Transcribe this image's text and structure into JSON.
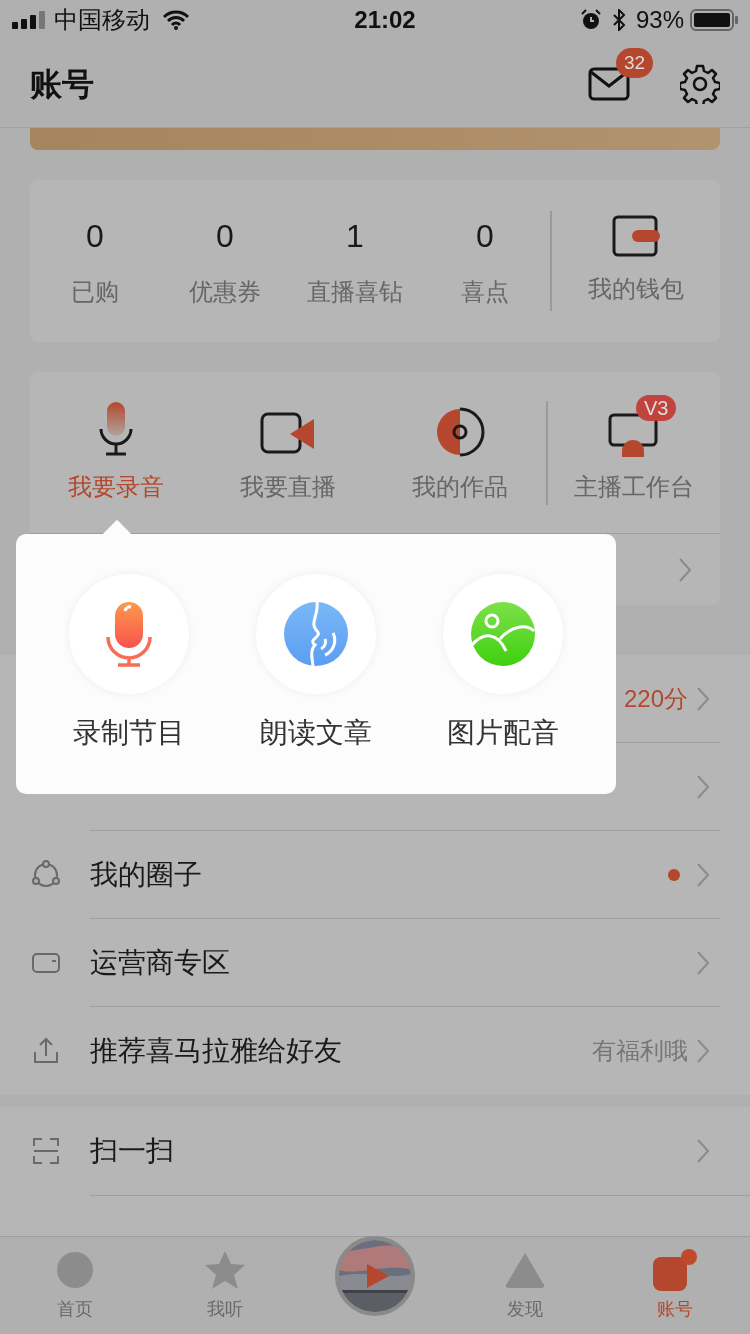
{
  "status_bar": {
    "carrier": "中国移动",
    "time": "21:02",
    "battery": "93%"
  },
  "header": {
    "title": "账号",
    "mail_badge": "32"
  },
  "stats": [
    {
      "value": "0",
      "label": "已购"
    },
    {
      "value": "0",
      "label": "优惠券"
    },
    {
      "value": "1",
      "label": "直播喜钻"
    },
    {
      "value": "0",
      "label": "喜点"
    }
  ],
  "wallet": {
    "label": "我的钱包"
  },
  "creator_actions": [
    {
      "kind": "mic",
      "label": "我要录音",
      "selected": true
    },
    {
      "kind": "live",
      "label": "我要直播",
      "selected": false
    },
    {
      "kind": "works",
      "label": "我的作品",
      "selected": false
    }
  ],
  "studio": {
    "label": "主播工作台",
    "badge": "V3"
  },
  "popup": {
    "items": [
      {
        "kind": "record",
        "label": "录制节目"
      },
      {
        "kind": "read",
        "label": "朗读文章"
      },
      {
        "kind": "dub",
        "label": "图片配音"
      }
    ]
  },
  "menu_groups": [
    [
      {
        "kind": "none",
        "value": "220分",
        "dot": false
      },
      {
        "kind": "none",
        "dot": false
      },
      {
        "kind": "circle",
        "label": "我的圈子",
        "dot": true
      },
      {
        "kind": "card",
        "label": "运营商专区",
        "dot": false
      },
      {
        "kind": "share",
        "label": "推荐喜马拉雅给好友",
        "value": "有福利哦",
        "dot": false
      }
    ],
    [
      {
        "kind": "scan",
        "label": "扫一扫",
        "dot": false
      }
    ]
  ],
  "tabs": [
    {
      "kind": "home",
      "label": "首页",
      "selected": false
    },
    {
      "kind": "star",
      "label": "我听",
      "selected": false
    },
    {
      "kind": "play",
      "selected": false
    },
    {
      "kind": "discover",
      "label": "发现",
      "selected": false
    },
    {
      "kind": "account",
      "label": "账号",
      "selected": true
    }
  ]
}
